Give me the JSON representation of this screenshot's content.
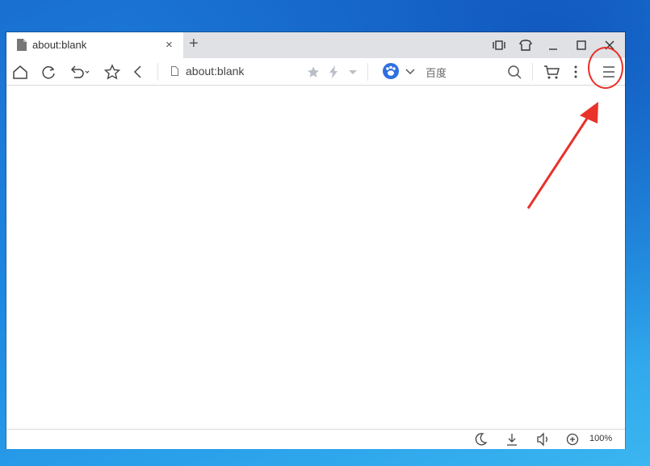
{
  "tab": {
    "title": "about:blank",
    "close": "×",
    "new_tab": "+"
  },
  "toolbar": {
    "address": "about:blank",
    "search_engine": "百度"
  },
  "statusbar": {
    "zoom": "100%"
  },
  "icons": [
    "document-icon",
    "close-icon",
    "plus-icon",
    "sidebar-icon",
    "skin-icon",
    "minimize-icon",
    "maximize-icon",
    "window-close-icon",
    "home-icon",
    "refresh-icon",
    "undo-icon",
    "star-icon",
    "back-icon",
    "page-icon",
    "bookmark-star-icon",
    "bolt-icon",
    "chevron-down-icon",
    "baidu-paw-icon",
    "search-icon",
    "cart-icon",
    "more-icon",
    "menu-icon",
    "moon-icon",
    "download-icon",
    "sound-icon",
    "zoom-icon"
  ],
  "colors": {
    "accent": "#2f6fe0",
    "annotation": "#e8322a",
    "desktop": "#1d86e0"
  }
}
